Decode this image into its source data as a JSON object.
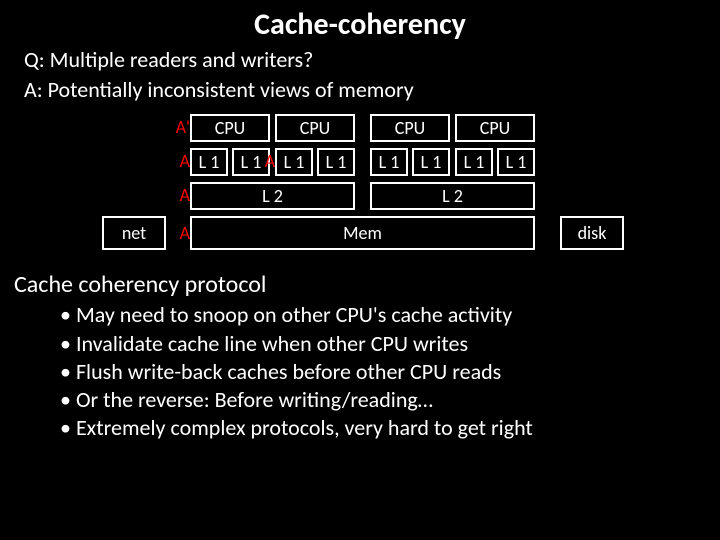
{
  "title": "Cache-coherency",
  "question": "Q: Multiple readers and writers?",
  "answer": "A: Potentially inconsistent views of memory",
  "diagram": {
    "cpus": [
      "CPU",
      "CPU",
      "CPU",
      "CPU"
    ],
    "l1": [
      "L 1",
      "L 1",
      "L 1",
      "L 1",
      "L 1",
      "L 1",
      "L 1",
      "L 1"
    ],
    "l2": [
      "L 2",
      "L 2"
    ],
    "net": "net",
    "mem": "Mem",
    "disk": "disk",
    "annotations": {
      "a_prime": "A'",
      "a_l1": "A",
      "a_l1b": "A",
      "a_l2": "A",
      "a_mem": "A"
    }
  },
  "protocol_heading": "Cache coherency protocol",
  "bullets": [
    "May need to snoop on other CPU's cache activity",
    "Invalidate cache line when other CPU writes",
    "Flush write-back caches before other CPU reads",
    "Or the reverse: Before writing/reading…",
    "Extremely complex protocols, very hard to get right"
  ]
}
